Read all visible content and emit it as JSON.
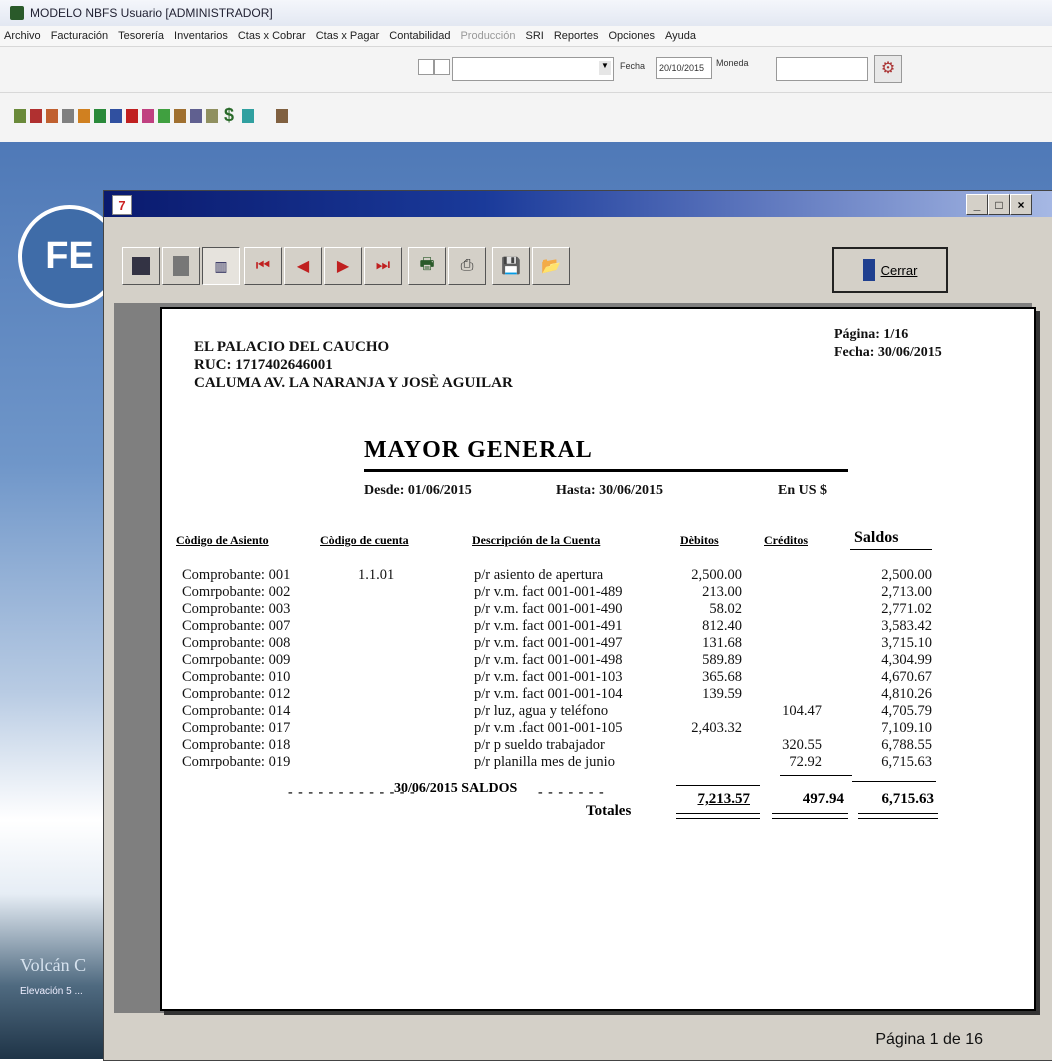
{
  "app": {
    "title": "MODELO NBFS   Usuario [ADMINISTRADOR]",
    "menu": [
      "Archivo",
      "Facturación",
      "Tesorería",
      "Inventarios",
      "Ctas x Cobrar",
      "Ctas x Pagar",
      "Contabilidad",
      "Producción",
      "SRI",
      "Reportes",
      "Opciones",
      "Ayuda"
    ],
    "fecha_label": "Fecha",
    "fecha_value": "20/10/2015",
    "moneda_label": "Moneda"
  },
  "desktop": {
    "logo_text": "FE",
    "bottom_text": "Volcán C",
    "bottom_sub": "Elevación 5 ..."
  },
  "report_window": {
    "close_label": "Cerrar",
    "status": "Página 1 de 16"
  },
  "report": {
    "company": "EL PALACIO DEL CAUCHO",
    "ruc": "RUC: 1717402646001",
    "address": "CALUMA AV. LA NARANJA Y JOSÈ AGUILAR",
    "page": "Página: 1/16",
    "date": "Fecha: 30/06/2015",
    "title": "MAYOR  GENERAL",
    "desde": "Desde: 01/06/2015",
    "hasta": "Hasta: 30/06/2015",
    "currency": "En US $",
    "headers": [
      "Còdigo de Asiento",
      "Còdigo de cuenta",
      "Descripción de la Cuenta",
      "Dèbitos",
      "Créditos",
      "Saldos"
    ],
    "rows": [
      [
        "Comprobante: 001",
        "1.1.01",
        "p/r asiento de apertura",
        "2,500.00",
        "",
        "2,500.00"
      ],
      [
        "Comrpobante: 002",
        "",
        "p/r v.m. fact 001-001-489",
        "213.00",
        "",
        "2,713.00"
      ],
      [
        "Comprobante: 003",
        "",
        "p/r v.m. fact 001-001-490",
        "58.02",
        "",
        "2,771.02"
      ],
      [
        "Comprobante: 007",
        "",
        "p/r v.m. fact 001-001-491",
        "812.40",
        "",
        "3,583.42"
      ],
      [
        "Comprobante: 008",
        "",
        "p/r v.m. fact 001-001-497",
        "131.68",
        "",
        "3,715.10"
      ],
      [
        "Comrpobante: 009",
        "",
        "p/r v.m. fact 001-001-498",
        "589.89",
        "",
        "4,304.99"
      ],
      [
        "Comprobante: 010",
        "",
        "p/r v.m. fact 001-001-103",
        "365.68",
        "",
        "4,670.67"
      ],
      [
        "Comprobante: 012",
        "",
        "p/r v.m. fact 001-001-104",
        "139.59",
        "",
        "4,810.26"
      ],
      [
        "Comprobante: 014",
        "",
        "p/r luz, agua y teléfono",
        "",
        "104.47",
        "4,705.79"
      ],
      [
        "Comprobante: 017",
        "",
        "p/r v.m .fact 001-001-105",
        "2,403.32",
        "",
        "7,109.10"
      ],
      [
        "Comprobante: 018",
        "",
        "p/r p sueldo trabajador",
        "",
        "320.55",
        "6,788.55"
      ],
      [
        "Comrpobante: 019",
        "",
        "p/r planilla mes de junio",
        "",
        "72.92",
        "6,715.63"
      ]
    ],
    "saldos_line": "30/06/2015 SALDOS",
    "totales_label": "Totales",
    "total_debitos": "7,213.57",
    "total_creditos": "497.94",
    "total_saldos": "6,715.63"
  }
}
